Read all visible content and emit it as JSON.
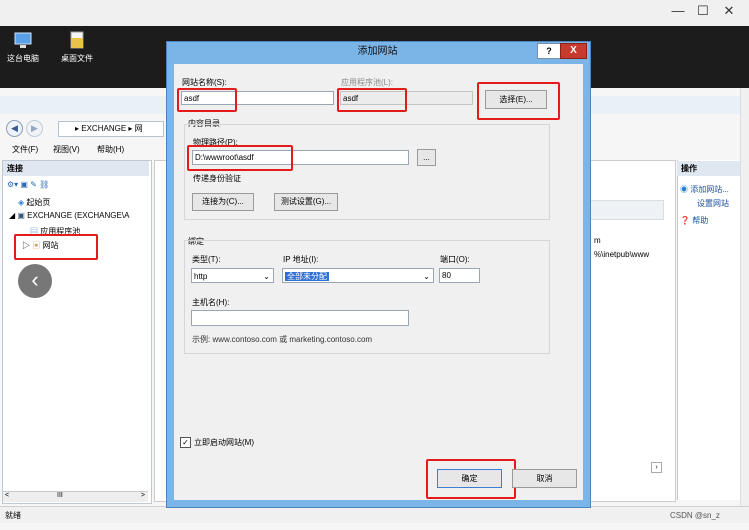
{
  "window": {
    "minimize": "—",
    "maximize": "☐",
    "close": "✕"
  },
  "desktop": {
    "icons": [
      {
        "label": "这台电脑",
        "icon": "computer-icon"
      },
      {
        "label": "桌面文件",
        "icon": "folder-icon"
      }
    ]
  },
  "iis": {
    "address": [
      "EXCHANGE",
      "网"
    ],
    "menu": [
      "文件(F)",
      "视图(V)",
      "帮助(H)"
    ],
    "connections": {
      "title": "连接",
      "tree": [
        "起始页",
        "EXCHANGE (EXCHANGE\\A",
        "应用程序池",
        "网站"
      ]
    },
    "middle": {
      "col_text1": "m",
      "col_text2": "%\\inetpub\\www"
    },
    "actions": {
      "title": "操作",
      "items": [
        "添加网站...",
        "设置网站",
        "帮助"
      ]
    },
    "status": "就绪"
  },
  "dialog": {
    "title": "添加网站",
    "help": "?",
    "close": "X",
    "site_name_label": "网站名称(S):",
    "site_name_value": "asdf",
    "app_pool_label": "应用程序池(L):",
    "app_pool_value": "asdf",
    "select_button": "选择(E)...",
    "content_dir_label": "内容目录",
    "physical_path_label": "物理路径(P):",
    "physical_path_value": "D:\\wwwroot\\asdf",
    "browse_button": "...",
    "passthrough_label": "传递身份验证",
    "connect_as_button": "连接为(C)...",
    "test_settings_button": "测试设置(G)...",
    "binding_label": "绑定",
    "type_label": "类型(T):",
    "type_value": "http",
    "ip_label": "IP 地址(I):",
    "ip_value": "全部未分配",
    "port_label": "端口(O):",
    "port_value": "80",
    "host_label": "主机名(H):",
    "host_value": "",
    "example": "示例: www.contoso.com 或 marketing.contoso.com",
    "start_checkbox_label": "立即启动网站(M)",
    "start_checked": "✓",
    "ok_button": "确定",
    "cancel_button": "取消"
  },
  "scroll": {
    "left": "<",
    "mid": "III",
    "right": ">"
  },
  "watermark": "CSDN @sn_z"
}
